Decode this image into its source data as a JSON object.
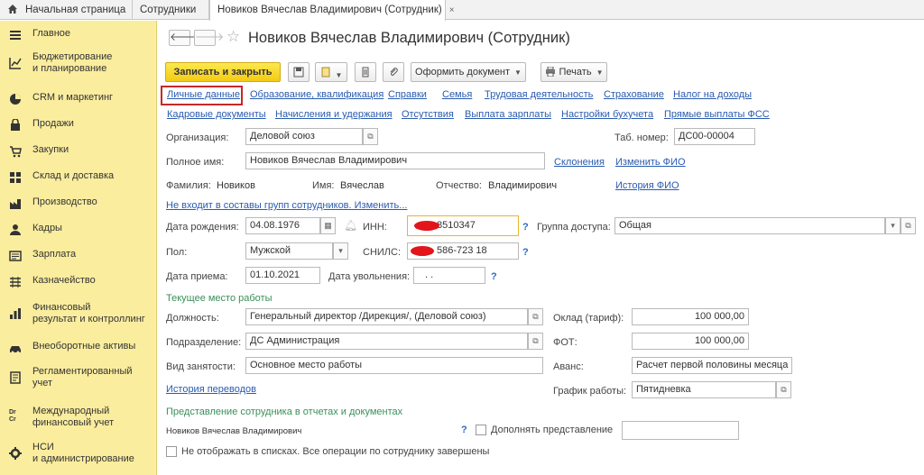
{
  "tabs": [
    {
      "label": "Начальная страница"
    },
    {
      "label": "Сотрудники"
    },
    {
      "label": "Новиков Вячеслав Владимирович (Сотрудник)",
      "close": "×"
    }
  ],
  "sidebar": {
    "items": [
      {
        "label": "Главное",
        "icon": "menu-icon"
      },
      {
        "label": "Бюджетирование\nи планирование",
        "icon": "chart-icon"
      },
      {
        "label": "CRM и маркетинг",
        "icon": "pie-icon"
      },
      {
        "label": "Продажи",
        "icon": "bag-icon"
      },
      {
        "label": "Закупки",
        "icon": "cart-icon"
      },
      {
        "label": "Склад и доставка",
        "icon": "warehouse-icon"
      },
      {
        "label": "Производство",
        "icon": "factory-icon"
      },
      {
        "label": "Кадры",
        "icon": "person-icon"
      },
      {
        "label": "Зарплата",
        "icon": "payroll-icon"
      },
      {
        "label": "Казначейство",
        "icon": "treasury-icon"
      },
      {
        "label": "Финансовый\nрезультат и контроллинг",
        "icon": "finance-icon"
      },
      {
        "label": "Внеоборотные активы",
        "icon": "car-icon"
      },
      {
        "label": "Регламентированный\nучет",
        "icon": "report-icon"
      },
      {
        "label": "Международный\nфинансовый учет",
        "icon": "intl-icon",
        "icon_text": "Dr\nCr"
      },
      {
        "label": "НСИ\nи администрирование",
        "icon": "gear-icon"
      }
    ]
  },
  "header": {
    "back": "🡐",
    "forward": "🡒",
    "title": "Новиков Вячеслав Владимирович (Сотрудник)"
  },
  "toolbar": {
    "save_close": "Записать и закрыть",
    "create_doc": "Оформить документ",
    "print": "Печать"
  },
  "links_row1": [
    "Личные данные",
    "Образование, квалификация",
    "Справки",
    "Семья",
    "Трудовая деятельность",
    "Страхование",
    "Налог на доходы"
  ],
  "links_row2": [
    "Кадровые документы",
    "Начисления и удержания",
    "Отсутствия",
    "Выплата зарплаты",
    "Настройки бухучета",
    "Прямые выплаты ФСС"
  ],
  "form": {
    "org_label": "Организация:",
    "org_value": "Деловой союз",
    "tab_label": "Таб. номер:",
    "tab_value": "ДС00-00004",
    "fullname_label": "Полное имя:",
    "fullname_value": "Новиков Вячеслав Владимирович",
    "inflect_link": "Склонения",
    "change_fio_link": "Изменить ФИО",
    "surname_label": "Фамилия:",
    "surname_value": "Новиков",
    "name_label": "Имя:",
    "name_value": "Вячеслав",
    "patronymic_label": "Отчество:",
    "patronymic_value": "Владимирович",
    "history_fio_link": "История ФИО",
    "groups_link": "Не входит в составы групп сотрудников. Изменить...",
    "birth_label": "Дата рождения:",
    "birth_value": "04.08.1976",
    "inn_label": "ИНН:",
    "inn_value": "8510347",
    "access_label": "Группа доступа:",
    "access_value": "Общая",
    "sex_label": "Пол:",
    "sex_value": "Мужской",
    "snils_label": "СНИЛС:",
    "snils_value": "586-723 18",
    "hire_label": "Дата приема:",
    "hire_value": "01.10.2021",
    "dismiss_label": "Дата увольнения:",
    "dismiss_value": ". .",
    "q": "?"
  },
  "workplace": {
    "section": "Текущее место работы",
    "position_label": "Должность:",
    "position_value": "Генеральный директор /Дирекция/, (Деловой союз)",
    "salary_label": "Оклад (тариф):",
    "salary_value": "100 000,00",
    "dept_label": "Подразделение:",
    "dept_value": "ДС Администрация",
    "fot_label": "ФОТ:",
    "fot_value": "100 000,00",
    "employment_label": "Вид занятости:",
    "employment_value": "Основное место работы",
    "advance_label": "Аванс:",
    "advance_value": "Расчет первой половины месяца",
    "transfers_link": "История переводов",
    "schedule_label": "График работы:",
    "schedule_value": "Пятидневка"
  },
  "representation": {
    "section": "Представление сотрудника в отчетах и документах",
    "value": "Новиков Вячеслав Владимирович",
    "q": "?",
    "extend_label": "Дополнять представление",
    "hide_label": "Не отображать в списках. Все операции по сотруднику завершены"
  },
  "colors": {
    "sidebar_bg": "#fbed9e",
    "primary_button": "#f4cb12",
    "link": "#2a5bb0",
    "section": "#3a8f5a",
    "highlight_box": "#c62828"
  }
}
